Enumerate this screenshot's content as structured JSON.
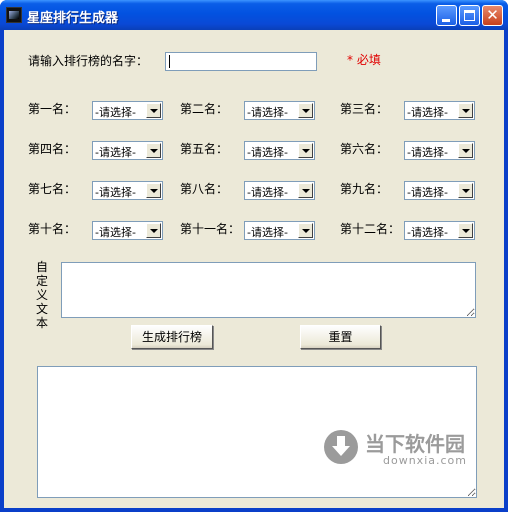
{
  "window": {
    "title": "星座排行生成器",
    "close_glyph": "✕"
  },
  "form": {
    "name_label": "请输入排行榜的名字：",
    "name_value": "",
    "required_text": "* 必填",
    "placeholder_option": "-请选择-",
    "ranks": [
      {
        "label": "第一名："
      },
      {
        "label": "第二名："
      },
      {
        "label": "第三名："
      },
      {
        "label": "第四名："
      },
      {
        "label": "第五名："
      },
      {
        "label": "第六名："
      },
      {
        "label": "第七名："
      },
      {
        "label": "第八名："
      },
      {
        "label": "第九名："
      },
      {
        "label": "第十名："
      },
      {
        "label": "第十一名："
      },
      {
        "label": "第十二名："
      }
    ],
    "custom_text_label": "自定义文本",
    "custom_text_value": "",
    "generate_button": "生成排行榜",
    "reset_button": "重置",
    "output_value": ""
  },
  "watermark": {
    "brand": "当下软件园",
    "url": "downxia.com"
  }
}
